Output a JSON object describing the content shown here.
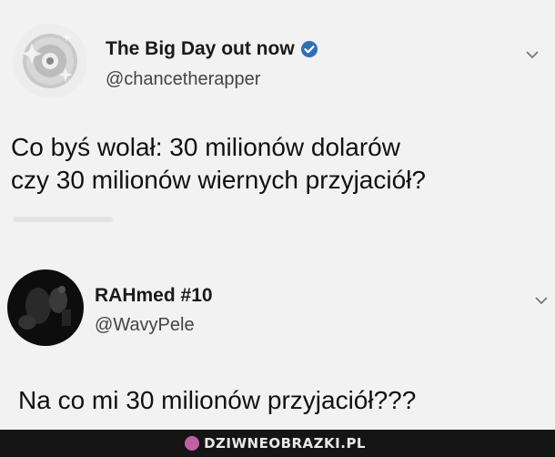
{
  "tweets": [
    {
      "display_name": "The Big Day out now",
      "handle": "@chancetherapper",
      "verified": true,
      "avatar_icon": "cd-disc-avatar",
      "text_lines": [
        "Co byś wolał: 30 milionów dolarów",
        "czy 30 milionów wiernych przyjaciół?"
      ]
    },
    {
      "display_name": "RAHmed #10",
      "handle": "@WavyPele",
      "verified": false,
      "avatar_icon": "dark-photo-avatar",
      "text_lines": [
        "Na co mi 30 milionów przyjaciół???"
      ]
    }
  ],
  "footer": {
    "brand": "DZIWNEOBRAZKI.PL",
    "brand_icon": "brand-logo-icon"
  },
  "colors": {
    "verified_blue": "#1d9bf0",
    "background": "#f2f2f2",
    "footer_bg": "#151515"
  }
}
